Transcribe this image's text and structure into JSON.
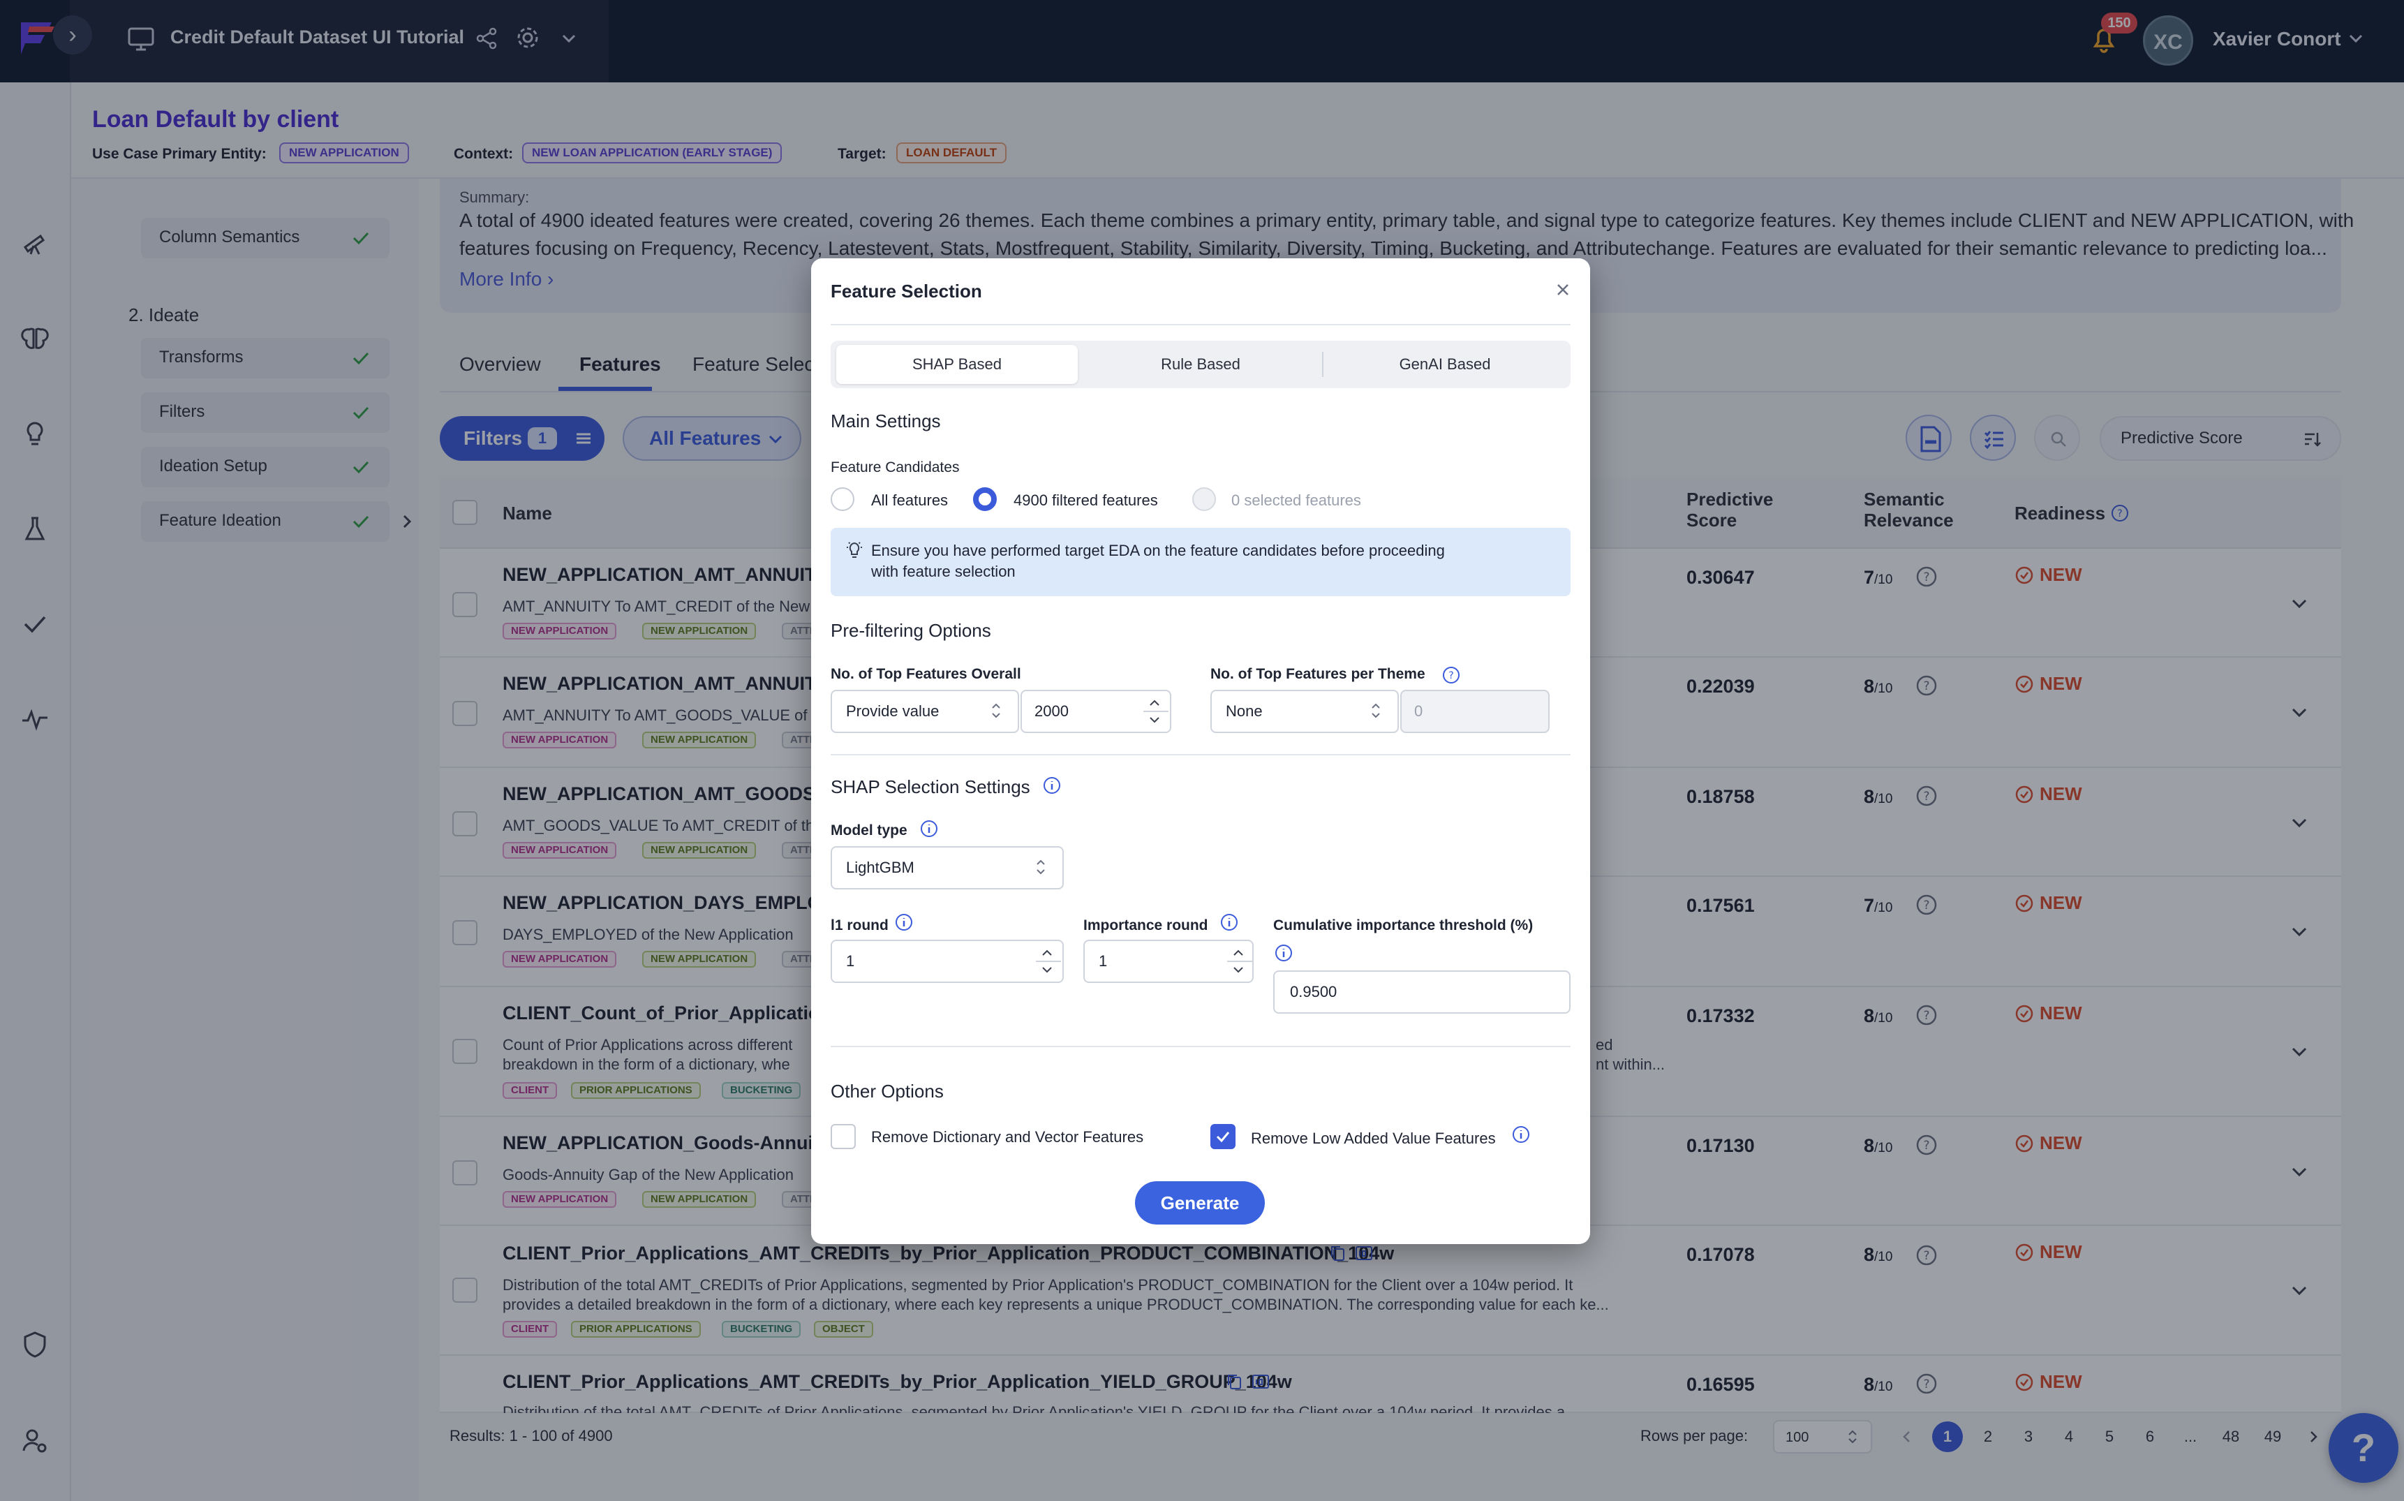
{
  "topbar": {
    "project_title": "Credit Default Dataset UI Tutorial",
    "notification_count": "150",
    "user_initials": "XC",
    "user_name": "Xavier Conort"
  },
  "header": {
    "title": "Loan Default by client",
    "entity_label": "Use Case Primary Entity:",
    "entity_value": "NEW APPLICATION",
    "context_label": "Context:",
    "context_value": "NEW LOAN APPLICATION (EARLY STAGE)",
    "target_label": "Target:",
    "target_value": "LOAN DEFAULT"
  },
  "steps": {
    "column_semantics": "Column Semantics",
    "section_ideate": "2. Ideate",
    "items": [
      "Transforms",
      "Filters",
      "Ideation Setup",
      "Feature Ideation"
    ]
  },
  "summary": {
    "label": "Summary:",
    "line1": "A total of 4900 ideated features were created, covering 26 themes. Each theme combines a primary entity, primary table, and signal type to categorize features. Key themes include CLIENT and NEW APPLICATION, with",
    "line2": "features focusing on Frequency, Recency, Latestevent, Stats, Mostfrequent, Stability, Similarity, Diversity, Timing, Bucketing, and Attributechange. Features are evaluated for their semantic relevance to predicting loa...",
    "more_info": "More Info"
  },
  "tabs": [
    "Overview",
    "Features",
    "Feature Select"
  ],
  "toolbar": {
    "filters_label": "Filters",
    "filters_count": "1",
    "all_features_label": "All Features",
    "sort_label": "Predictive Score"
  },
  "table": {
    "headers": {
      "name": "Name",
      "score_1": "Predictive",
      "score_2": "Score",
      "relevance_1": "Semantic",
      "relevance_2": "Relevance",
      "readiness": "Readiness"
    },
    "rows": [
      {
        "title": "NEW_APPLICATION_AMT_ANNUITY_",
        "desc": "AMT_ANNUITY To AMT_CREDIT of the New",
        "tags": [
          "NEW APPLICATION",
          "NEW APPLICATION",
          "ATTR"
        ],
        "score": "0.30647",
        "relevance": "7",
        "readiness": "NEW"
      },
      {
        "title": "NEW_APPLICATION_AMT_ANNUITY_",
        "desc": "AMT_ANNUITY To AMT_GOODS_VALUE of",
        "tags": [
          "NEW APPLICATION",
          "NEW APPLICATION",
          "ATTR"
        ],
        "score": "0.22039",
        "relevance": "8",
        "readiness": "NEW"
      },
      {
        "title": "NEW_APPLICATION_AMT_GOODS_V",
        "desc": "AMT_GOODS_VALUE To AMT_CREDIT of th",
        "tags": [
          "NEW APPLICATION",
          "NEW APPLICATION",
          "ATTR"
        ],
        "score": "0.18758",
        "relevance": "8",
        "readiness": "NEW"
      },
      {
        "title": "NEW_APPLICATION_DAYS_EMPLOY",
        "desc": "DAYS_EMPLOYED of the New Application",
        "tags": [
          "NEW APPLICATION",
          "NEW APPLICATION",
          "ATTR"
        ],
        "score": "0.17561",
        "relevance": "7",
        "readiness": "NEW"
      },
      {
        "title": "CLIENT_Count_of_Prior_Applications",
        "desc": "Count of Prior Applications across different",
        "desc2": "breakdown in the form of a dictionary, whe",
        "desc_r1": "ed",
        "desc_r2": "nt within...",
        "tags": [
          "CLIENT",
          "PRIOR APPLICATIONS",
          "BUCKETING"
        ],
        "score": "0.17332",
        "relevance": "8",
        "readiness": "NEW"
      },
      {
        "title": "NEW_APPLICATION_Goods-Annuity_",
        "desc": "Goods-Annuity Gap of the New Application",
        "tags": [
          "NEW APPLICATION",
          "NEW APPLICATION",
          "ATTR"
        ],
        "score": "0.17130",
        "relevance": "8",
        "readiness": "NEW"
      },
      {
        "title": "CLIENT_Prior_Applications_AMT_CREDITs_by_Prior_Application_PRODUCT_COMBINATION_104w",
        "desc": "Distribution of the total AMT_CREDITs of Prior Applications, segmented by Prior Application's PRODUCT_COMBINATION for the Client over a 104w period. It",
        "desc2": "provides a detailed breakdown in the form of a dictionary, where each key represents a unique PRODUCT_COMBINATION. The corresponding value for each ke...",
        "tags": [
          "CLIENT",
          "PRIOR APPLICATIONS",
          "BUCKETING",
          "OBJECT"
        ],
        "score": "0.17078",
        "relevance": "8",
        "readiness": "NEW"
      },
      {
        "title": "CLIENT_Prior_Applications_AMT_CREDITs_by_Prior_Application_YIELD_GROUP_104w",
        "desc": "Distribution of the total AMT_CREDITs of Prior Applications, segmented by Prior Application's YIELD_GROUP for the Client over a 104w period. It provides a",
        "tags": [],
        "score": "0.16595",
        "relevance": "8",
        "readiness": "NEW"
      }
    ],
    "relevance_suffix": "/10"
  },
  "footer": {
    "results": "Results: 1 - 100 of 4900",
    "rows_per_page_label": "Rows per page:",
    "rows_per_page_value": "100",
    "pages": [
      "1",
      "2",
      "3",
      "4",
      "5",
      "6",
      "...",
      "48",
      "49"
    ]
  },
  "modal": {
    "title": "Feature Selection",
    "tabs": [
      "SHAP Based",
      "Rule Based",
      "GenAI Based"
    ],
    "main_settings": "Main Settings",
    "feature_candidates_label": "Feature Candidates",
    "candidates": [
      "All features",
      "4900 filtered features",
      "0 selected features"
    ],
    "info_line1": "Ensure you have performed target EDA on the feature candidates before proceeding",
    "info_line2": "with feature selection",
    "prefilter_head": "Pre-filtering Options",
    "top_overall_label": "No. of Top Features Overall",
    "top_overall_mode": "Provide value",
    "top_overall_value": "2000",
    "top_theme_label": "No. of Top Features per Theme",
    "top_theme_mode": "None",
    "top_theme_value": "0",
    "shap_head": "SHAP Selection Settings",
    "model_type_label": "Model type",
    "model_type_value": "LightGBM",
    "l1_label": "l1 round",
    "l1_value": "1",
    "importance_label": "Importance round",
    "importance_value": "1",
    "cumulative_label": "Cumulative importance threshold (%)",
    "cumulative_value": "0.9500",
    "other_head": "Other Options",
    "remove_dict_label": "Remove Dictionary and Vector Features",
    "remove_low_label": "Remove Low Added Value Features",
    "generate_label": "Generate"
  },
  "colors": {
    "accent": "#3b5bdb",
    "title_purple": "#4b2ccf",
    "topbar": "#111a2e",
    "ready_new": "#dc4a2a"
  }
}
